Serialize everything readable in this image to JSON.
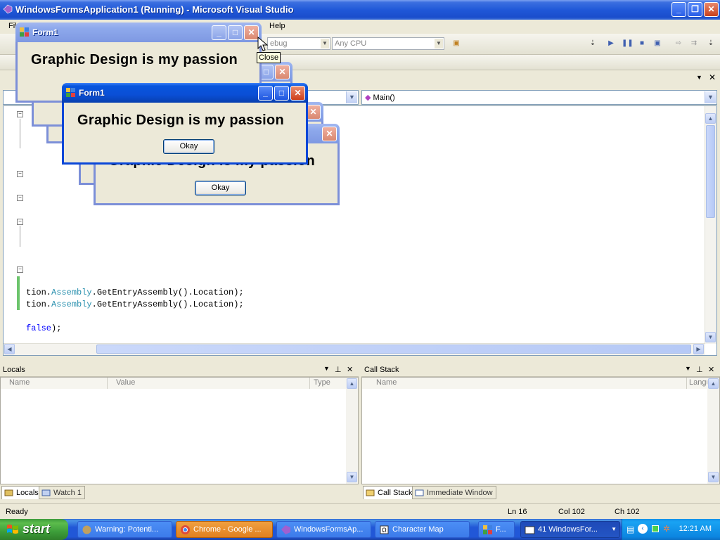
{
  "vs": {
    "title": "WindowsFormsApplication1 (Running) - Microsoft Visual Studio",
    "menu": [
      "Fil",
      "Help"
    ],
    "config_combo": "ebug",
    "platform_combo": "Any CPU",
    "member_combo": "Main()"
  },
  "code_lines": [
    {
      "pre": "tion.",
      "type": "Assembly",
      "post": ".GetEntryAssembly().Location);"
    },
    {
      "pre": "tion.",
      "type": "Assembly",
      "post": ".GetEntryAssembly().Location);"
    },
    {
      "kw": "false",
      "post": ");"
    }
  ],
  "locals": {
    "title": "Locals",
    "columns": [
      "Name",
      "Value",
      "Type"
    ],
    "tabs": [
      "Locals",
      "Watch 1"
    ]
  },
  "callstack": {
    "title": "Call Stack",
    "columns": [
      "Name",
      "Langu"
    ],
    "tabs": [
      "Call Stack",
      "Immediate Window"
    ]
  },
  "status": {
    "text": "Ready",
    "ln": "Ln 16",
    "col": "Col 102",
    "ch": "Ch 102"
  },
  "tooltip": "Close",
  "form": {
    "title": "Form1",
    "message": "Graphic Design is my passion",
    "button": "Okay"
  },
  "taskbar": {
    "start": "start",
    "buttons": [
      "Warning: Potenti...",
      "Chrome - Google ...",
      "WindowsFormsAp...",
      "Character Map",
      "F...",
      "41 WindowsFor..."
    ],
    "clock": "12:21 AM"
  },
  "colors": {
    "xp_blue": "#0a47d8",
    "xp_green": "#3d9e3a",
    "keyword": "#0000ff",
    "type": "#2b91af"
  }
}
